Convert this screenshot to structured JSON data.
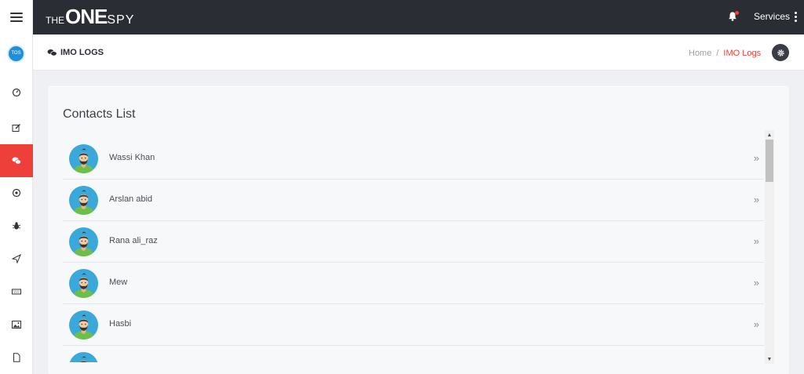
{
  "sidebar": {
    "avatar_initials": "TOS",
    "items": [
      {
        "icon": "dashboard-icon",
        "active": false
      },
      {
        "icon": "edit-icon",
        "active": false
      },
      {
        "icon": "chat-icon",
        "active": true
      },
      {
        "icon": "target-icon",
        "active": false
      },
      {
        "icon": "bug-icon",
        "active": false
      },
      {
        "icon": "send-icon",
        "active": false
      },
      {
        "icon": "keyboard-icon",
        "active": false
      },
      {
        "icon": "image-icon",
        "active": false
      },
      {
        "icon": "file-icon",
        "active": false
      }
    ]
  },
  "topbar": {
    "logo_the": "THE",
    "logo_one": "ONE",
    "logo_spy": "SPY",
    "services_label": "Services"
  },
  "page_header": {
    "title": "IMO LOGS",
    "breadcrumb_home": "Home",
    "breadcrumb_sep": "/",
    "breadcrumb_current": "IMO Logs"
  },
  "card": {
    "title": "Contacts List",
    "contacts": [
      {
        "name": "Wassi Khan"
      },
      {
        "name": "Arslan abid"
      },
      {
        "name": "Rana ali_raz"
      },
      {
        "name": "Mew"
      },
      {
        "name": "Hasbi"
      },
      {
        "name": ""
      }
    ],
    "chevron": "»"
  },
  "colors": {
    "accent": "#ef3f3a",
    "topbar": "#2b2d35",
    "avatar_bg": "#3aa8d8",
    "avatar_shirt": "#6bbf4a"
  }
}
